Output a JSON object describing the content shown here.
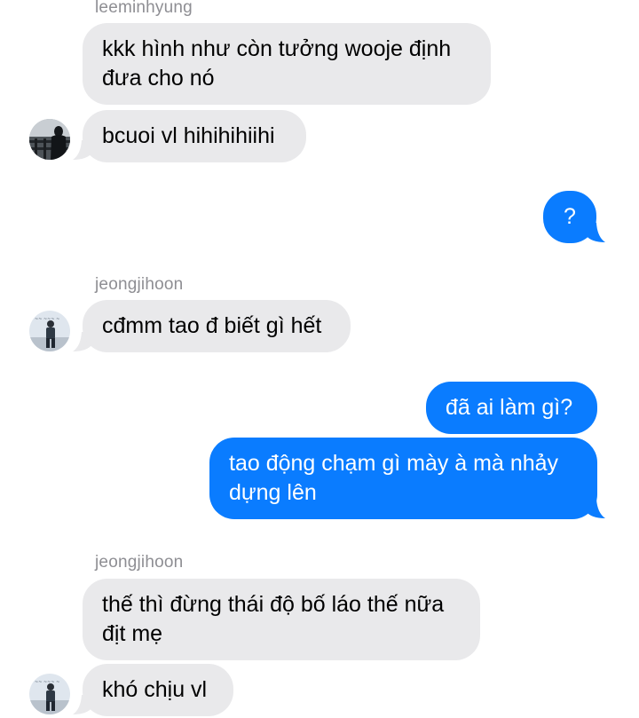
{
  "conversation": {
    "groups": [
      {
        "sender": "leeminhyung",
        "messages": [
          "kkk hình như còn tưởng wooje định đưa cho nó",
          "bcuoi vl hihihihiihi"
        ]
      },
      {
        "outgoing": [
          "?"
        ]
      },
      {
        "sender": "jeongjihoon",
        "messages": [
          "cđmm tao đ biết gì hết"
        ]
      },
      {
        "outgoing": [
          "đã ai làm gì?",
          "tao động chạm gì mày à mà nhảy dựng lên"
        ]
      },
      {
        "sender": "jeongjihoon",
        "messages": [
          "thế thì đừng thái độ bố láo thế nữa địt mẹ",
          "khó chịu vl"
        ]
      }
    ]
  },
  "colors": {
    "incoming_bubble": "#e9e9eb",
    "outgoing_bubble": "#0a7cff",
    "sender_name": "#8e8e93"
  },
  "icons": {
    "avatar_leeminhyung": "avatar-photo-silhouette-railing",
    "avatar_jeongjihoon": "avatar-photo-standing-figure"
  }
}
